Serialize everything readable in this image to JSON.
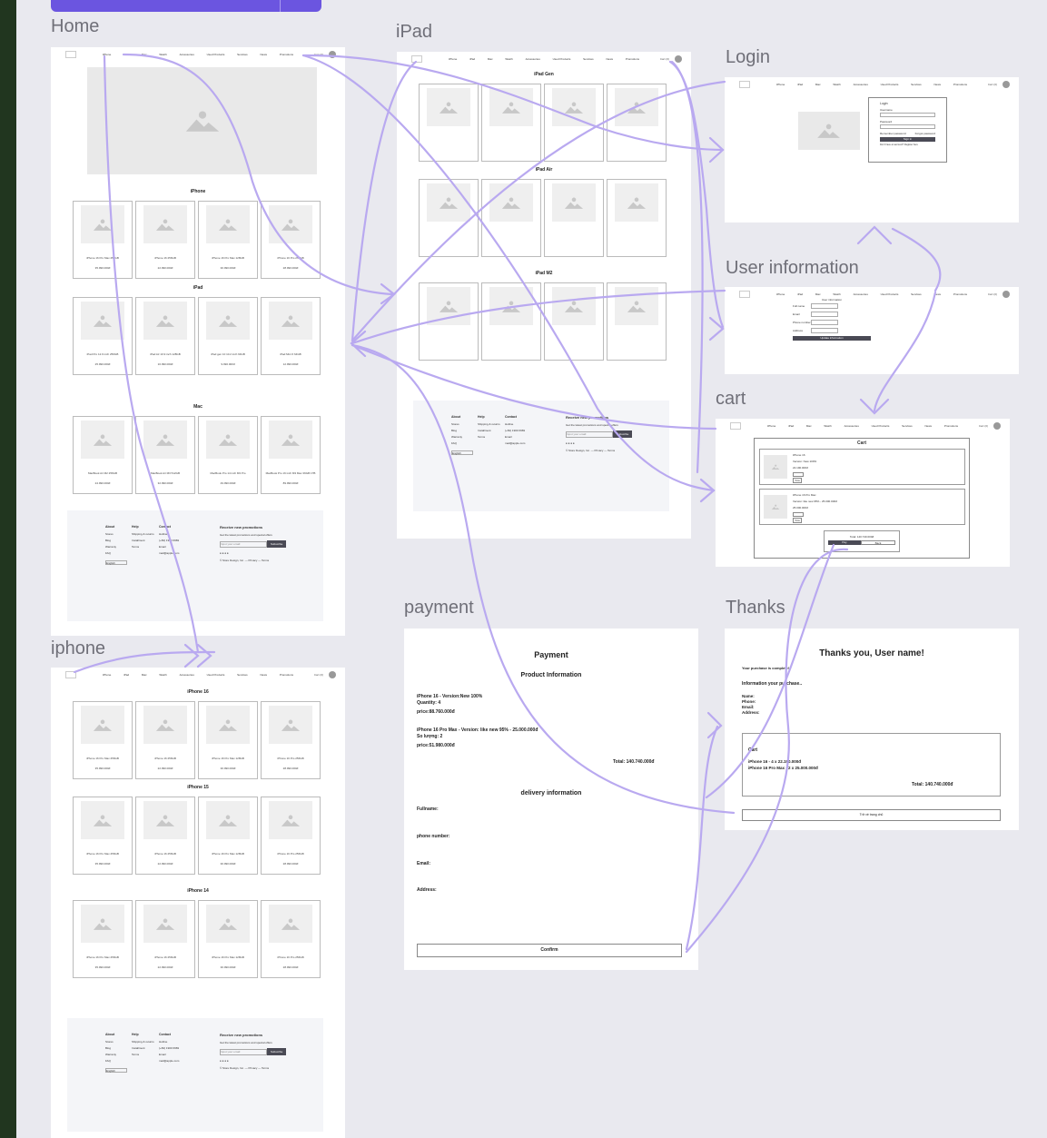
{
  "frames": {
    "home": "Home",
    "ipad": "iPad",
    "login": "Login",
    "user_info": "User information",
    "cart": "cart",
    "payment": "payment",
    "thanks": "Thanks",
    "iphone": "iphone"
  },
  "nav": {
    "items": [
      "iPhone",
      "iPad",
      "Mac",
      "Watch",
      "Accessories",
      "Used Products",
      "Services",
      "News",
      "Promotions"
    ],
    "cart_label": "Cart (0)"
  },
  "home": {
    "sections": [
      "iPhone",
      "iPad",
      "Mac"
    ],
    "iphone_products": [
      {
        "name": "iPhone 16 Pro Max 256GB",
        "price": "35.990.000đ"
      },
      {
        "name": "iPhone 16 256GB",
        "price": "22.990.000đ"
      },
      {
        "name": "iPhone 16 Pro Max 128GB",
        "price": "30.990.000đ"
      },
      {
        "name": "iPhone 16 Pro 256GB",
        "price": "28.990.000đ"
      }
    ],
    "ipad_products": [
      {
        "name": "iPad Pro 12.9 inch 256GB",
        "price": "25.990.000đ"
      },
      {
        "name": "iPad Air 10.9 inch 128GB",
        "price": "16.990.000đ"
      },
      {
        "name": "iPad gen 10 10.2 inch 64GB",
        "price": "9.990.000đ"
      },
      {
        "name": "iPad Mini 6 64GB",
        "price": "12.990.000đ"
      }
    ],
    "mac_products": [
      {
        "name": "MacBook Air M2 256GB",
        "price": "24.990.000đ"
      },
      {
        "name": "MacBook Air M3 512GB",
        "price": "32.990.000đ"
      },
      {
        "name": "MacBook Pro 14 inch M3 Pro",
        "price": "49.990.000đ"
      },
      {
        "name": "MacBook Pro 16 inch M3 Max 36GB 1TB",
        "price": "89.990.000đ"
      }
    ]
  },
  "ipad": {
    "sections": [
      "iPad Gen",
      "iPad Air",
      "iPad M2"
    ]
  },
  "iphone_page": {
    "sections": [
      "iPhone 16",
      "iPhone 15",
      "iPhone 14"
    ]
  },
  "footer": {
    "about_title": "About",
    "about_items": [
      "Stores",
      "Blog",
      "Warranty",
      "FAQ"
    ],
    "help_title": "Help",
    "help_items": [
      "Shipping & returns",
      "Installment",
      "Terms"
    ],
    "contact_title": "Contact",
    "contact_items": [
      "Hotline",
      "(+84) 1900 6969",
      "Email",
      "mail@apple.com"
    ],
    "promo_title": "Receive new promotions",
    "promo_text": "Get the latest promotions and special offers",
    "email_placeholder": "Input your email",
    "subscribe": "Subscribe",
    "language": "English",
    "copyright": "© Store Design, Inc. — Privacy — Terms"
  },
  "login": {
    "title": "Login",
    "user_label": "Username",
    "pass_label": "Password",
    "remember": "Remember password",
    "forgot": "Forgot password",
    "button": "Sign in",
    "register": "Don't have an account? Register here"
  },
  "user_info": {
    "title": "User information",
    "fields": [
      "Full name",
      "Email",
      "Phone number",
      "Address"
    ],
    "button": "Update information"
  },
  "cart": {
    "title": "Cart",
    "item1_name": "iPhone 16",
    "item1_version": "Version: New 100%",
    "item1_price": "22.190.000đ",
    "item2_name": "iPhone 16 Pro Max",
    "item2_version": "Version: like new 95% - 25.000.000đ",
    "item2_price": "25.000.000đ",
    "delete": "Xóa",
    "total": "Total: 140.740.000đ",
    "checkout": "Pay",
    "continue": "Back"
  },
  "payment": {
    "title": "Payment",
    "product_info": "Product Information",
    "line1": "iPhone 16 - Version:New 100%",
    "line2": "Quantity: 4",
    "line3": "price:88.760.000đ",
    "line4": "iPhone 16 Pro Max - Version: like new 95% - 25.000.000đ",
    "line5": "So lượng: 2",
    "line6": "price:51.980.000đ",
    "total": "Total: 140.740.000đ",
    "delivery": "delivery information",
    "fullname": "Fullname:",
    "phone": "phone number:",
    "email": "Email:",
    "address": "Address:",
    "confirm": "Confirm"
  },
  "thanks": {
    "title": "Thanks you,  User name!",
    "complete": "Your purchase is complete!",
    "info": "Information your purchase..",
    "name": "Name:",
    "phone": "Phone:",
    "email": "Email:",
    "address": "Address:",
    "cart": "Cart",
    "line1": "iPhone 16 - 4 x 22.190.000đ",
    "line2": "iPhone 16 Pro Max - 2 x 25.000.000đ",
    "total": "Total: 140.740.000đ",
    "back": "Trở về trang chủ"
  },
  "colors": {
    "canvas": "#e9e9ef",
    "outer": "#21361f",
    "arrow": "#b9a9f0",
    "accent": "#6b55e0"
  }
}
